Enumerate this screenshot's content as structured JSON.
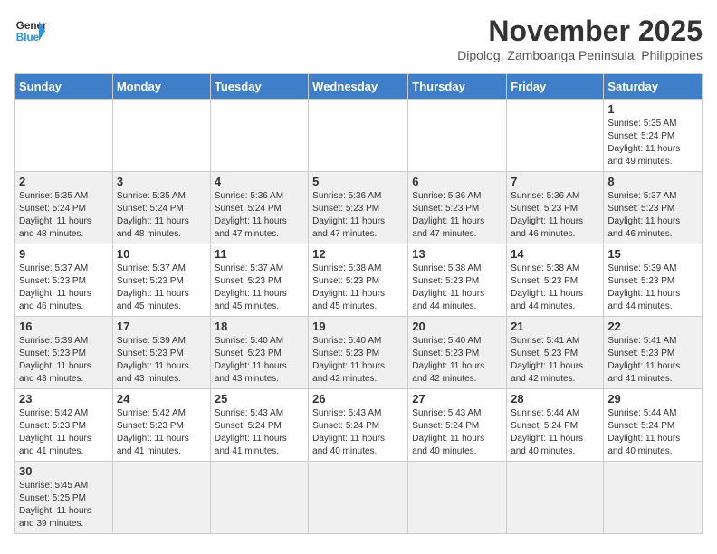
{
  "header": {
    "logo_general": "General",
    "logo_blue": "Blue",
    "month_title": "November 2025",
    "subtitle": "Dipolog, Zamboanga Peninsula, Philippines"
  },
  "days_of_week": [
    "Sunday",
    "Monday",
    "Tuesday",
    "Wednesday",
    "Thursday",
    "Friday",
    "Saturday"
  ],
  "weeks": [
    [
      {
        "day": "",
        "info": ""
      },
      {
        "day": "",
        "info": ""
      },
      {
        "day": "",
        "info": ""
      },
      {
        "day": "",
        "info": ""
      },
      {
        "day": "",
        "info": ""
      },
      {
        "day": "",
        "info": ""
      },
      {
        "day": "1",
        "info": "Sunrise: 5:35 AM\nSunset: 5:24 PM\nDaylight: 11 hours\nand 49 minutes."
      }
    ],
    [
      {
        "day": "2",
        "info": "Sunrise: 5:35 AM\nSunset: 5:24 PM\nDaylight: 11 hours\nand 48 minutes."
      },
      {
        "day": "3",
        "info": "Sunrise: 5:35 AM\nSunset: 5:24 PM\nDaylight: 11 hours\nand 48 minutes."
      },
      {
        "day": "4",
        "info": "Sunrise: 5:36 AM\nSunset: 5:24 PM\nDaylight: 11 hours\nand 47 minutes."
      },
      {
        "day": "5",
        "info": "Sunrise: 5:36 AM\nSunset: 5:23 PM\nDaylight: 11 hours\nand 47 minutes."
      },
      {
        "day": "6",
        "info": "Sunrise: 5:36 AM\nSunset: 5:23 PM\nDaylight: 11 hours\nand 47 minutes."
      },
      {
        "day": "7",
        "info": "Sunrise: 5:36 AM\nSunset: 5:23 PM\nDaylight: 11 hours\nand 46 minutes."
      },
      {
        "day": "8",
        "info": "Sunrise: 5:37 AM\nSunset: 5:23 PM\nDaylight: 11 hours\nand 46 minutes."
      }
    ],
    [
      {
        "day": "9",
        "info": "Sunrise: 5:37 AM\nSunset: 5:23 PM\nDaylight: 11 hours\nand 46 minutes."
      },
      {
        "day": "10",
        "info": "Sunrise: 5:37 AM\nSunset: 5:23 PM\nDaylight: 11 hours\nand 45 minutes."
      },
      {
        "day": "11",
        "info": "Sunrise: 5:37 AM\nSunset: 5:23 PM\nDaylight: 11 hours\nand 45 minutes."
      },
      {
        "day": "12",
        "info": "Sunrise: 5:38 AM\nSunset: 5:23 PM\nDaylight: 11 hours\nand 45 minutes."
      },
      {
        "day": "13",
        "info": "Sunrise: 5:38 AM\nSunset: 5:23 PM\nDaylight: 11 hours\nand 44 minutes."
      },
      {
        "day": "14",
        "info": "Sunrise: 5:38 AM\nSunset: 5:23 PM\nDaylight: 11 hours\nand 44 minutes."
      },
      {
        "day": "15",
        "info": "Sunrise: 5:39 AM\nSunset: 5:23 PM\nDaylight: 11 hours\nand 44 minutes."
      }
    ],
    [
      {
        "day": "16",
        "info": "Sunrise: 5:39 AM\nSunset: 5:23 PM\nDaylight: 11 hours\nand 43 minutes."
      },
      {
        "day": "17",
        "info": "Sunrise: 5:39 AM\nSunset: 5:23 PM\nDaylight: 11 hours\nand 43 minutes."
      },
      {
        "day": "18",
        "info": "Sunrise: 5:40 AM\nSunset: 5:23 PM\nDaylight: 11 hours\nand 43 minutes."
      },
      {
        "day": "19",
        "info": "Sunrise: 5:40 AM\nSunset: 5:23 PM\nDaylight: 11 hours\nand 42 minutes."
      },
      {
        "day": "20",
        "info": "Sunrise: 5:40 AM\nSunset: 5:23 PM\nDaylight: 11 hours\nand 42 minutes."
      },
      {
        "day": "21",
        "info": "Sunrise: 5:41 AM\nSunset: 5:23 PM\nDaylight: 11 hours\nand 42 minutes."
      },
      {
        "day": "22",
        "info": "Sunrise: 5:41 AM\nSunset: 5:23 PM\nDaylight: 11 hours\nand 41 minutes."
      }
    ],
    [
      {
        "day": "23",
        "info": "Sunrise: 5:42 AM\nSunset: 5:23 PM\nDaylight: 11 hours\nand 41 minutes."
      },
      {
        "day": "24",
        "info": "Sunrise: 5:42 AM\nSunset: 5:23 PM\nDaylight: 11 hours\nand 41 minutes."
      },
      {
        "day": "25",
        "info": "Sunrise: 5:43 AM\nSunset: 5:24 PM\nDaylight: 11 hours\nand 41 minutes."
      },
      {
        "day": "26",
        "info": "Sunrise: 5:43 AM\nSunset: 5:24 PM\nDaylight: 11 hours\nand 40 minutes."
      },
      {
        "day": "27",
        "info": "Sunrise: 5:43 AM\nSunset: 5:24 PM\nDaylight: 11 hours\nand 40 minutes."
      },
      {
        "day": "28",
        "info": "Sunrise: 5:44 AM\nSunset: 5:24 PM\nDaylight: 11 hours\nand 40 minutes."
      },
      {
        "day": "29",
        "info": "Sunrise: 5:44 AM\nSunset: 5:24 PM\nDaylight: 11 hours\nand 40 minutes."
      }
    ],
    [
      {
        "day": "30",
        "info": "Sunrise: 5:45 AM\nSunset: 5:25 PM\nDaylight: 11 hours\nand 39 minutes."
      },
      {
        "day": "",
        "info": ""
      },
      {
        "day": "",
        "info": ""
      },
      {
        "day": "",
        "info": ""
      },
      {
        "day": "",
        "info": ""
      },
      {
        "day": "",
        "info": ""
      },
      {
        "day": "",
        "info": ""
      }
    ]
  ]
}
